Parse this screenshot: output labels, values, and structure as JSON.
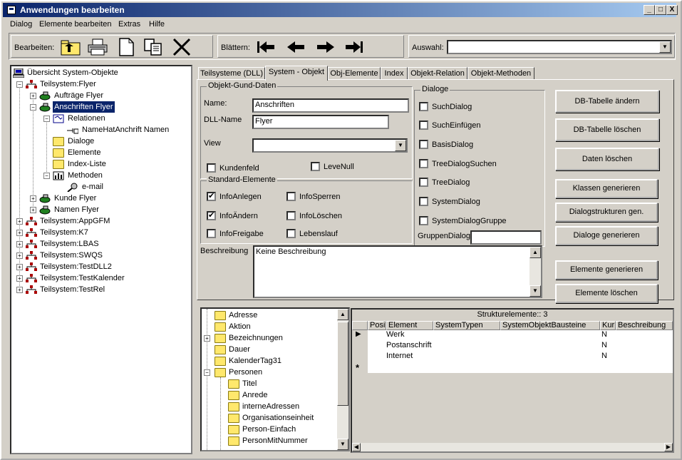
{
  "window": {
    "title": "Anwendungen bearbeiten",
    "min": "_",
    "max": "□",
    "close": "X"
  },
  "menu": [
    "Dialog",
    "Elemente bearbeiten",
    "Extras",
    "Hilfe"
  ],
  "toolbar": {
    "edit_label": "Bearbeiten:",
    "browse_label": "Blättern:",
    "select_label": "Auswahl:",
    "select_value": ""
  },
  "tree": {
    "root": "Übersicht System-Objekte",
    "items": [
      {
        "label": "Teilsystem:Flyer"
      },
      {
        "label": "Aufträge  Flyer"
      },
      {
        "label": "Anschriften  Flyer"
      },
      {
        "label": "Relationen"
      },
      {
        "label": "NameHatAnchrift  Namen"
      },
      {
        "label": "Dialoge"
      },
      {
        "label": "Elemente"
      },
      {
        "label": "Index-Liste"
      },
      {
        "label": "Methoden"
      },
      {
        "label": "e-mail"
      },
      {
        "label": "Kunde  Flyer"
      },
      {
        "label": "Namen  Flyer"
      },
      {
        "label": "Teilsystem:AppGFM"
      },
      {
        "label": "Teilsystem:K7"
      },
      {
        "label": "Teilsystem:LBAS"
      },
      {
        "label": "Teilsystem:SWQS"
      },
      {
        "label": "Teilsystem:TestDLL2"
      },
      {
        "label": "Teilsystem:TestKalender"
      },
      {
        "label": "Teilsystem:TestRel"
      }
    ]
  },
  "tabs": [
    "Teilsysteme (DLL)",
    "System - Objekt",
    "Obj-Elemente",
    "Index",
    "Objekt-Relation",
    "Objekt-Methoden"
  ],
  "form": {
    "group_basic": "Objekt-Gund-Daten",
    "name_label": "Name:",
    "name_value": "Anschriften",
    "dll_label": "DLL-Name",
    "dll_value": "Flyer",
    "view_label": "View",
    "view_value": "",
    "kundenfeld": "Kundenfeld",
    "levenull": "LeveNull",
    "group_std": "Standard-Elemente",
    "std": [
      "InfoAnlegen",
      "InfoSperren",
      "InfoÄndern",
      "InfoLöschen",
      "InfoFreigabe",
      "Lebenslauf"
    ],
    "std_checked": [
      "✔",
      "",
      "✔",
      "",
      "",
      ""
    ],
    "group_dialoge": "Dialoge",
    "dialoge": [
      "SuchDialog",
      "SuchEinfügen",
      "BasisDialog",
      "TreeDialogSuchen",
      "TreeDialog",
      "SystemDialog",
      "SystemDialogGruppe"
    ],
    "gruppen_label": "GruppenDialog",
    "gruppen_value": "",
    "beschreibung_label": "Beschreibung",
    "beschreibung_value": "Keine Beschreibung"
  },
  "buttons": [
    "DB-Tabelle ändern",
    "DB-Tabelle löschen",
    "Daten löschen",
    "Klassen generieren",
    "Dialogstrukturen gen.",
    "Dialoge generieren",
    "Elemente generieren",
    "Elemente löschen"
  ],
  "tree2": [
    "Adresse",
    "Aktion",
    "Bezeichnungen",
    "Dauer",
    "KalenderTag31",
    "Personen",
    "Titel",
    "Anrede",
    "interneAdressen",
    "Organisationseinheit",
    "Person-Einfach",
    "PersonMitNummer"
  ],
  "grid": {
    "caption": "Strukturelemente:: 3",
    "headers": [
      "Posi",
      "Element",
      "SystemTypen",
      "SystemObjektBausteine",
      "Kur",
      "Beschreibung"
    ],
    "rows": [
      {
        "element": "Werk",
        "kur": "N"
      },
      {
        "element": "Postanschrift",
        "kur": "N"
      },
      {
        "element": "Internet",
        "kur": "N"
      }
    ],
    "new_row_marker": "*",
    "current_row_marker": "▶"
  }
}
